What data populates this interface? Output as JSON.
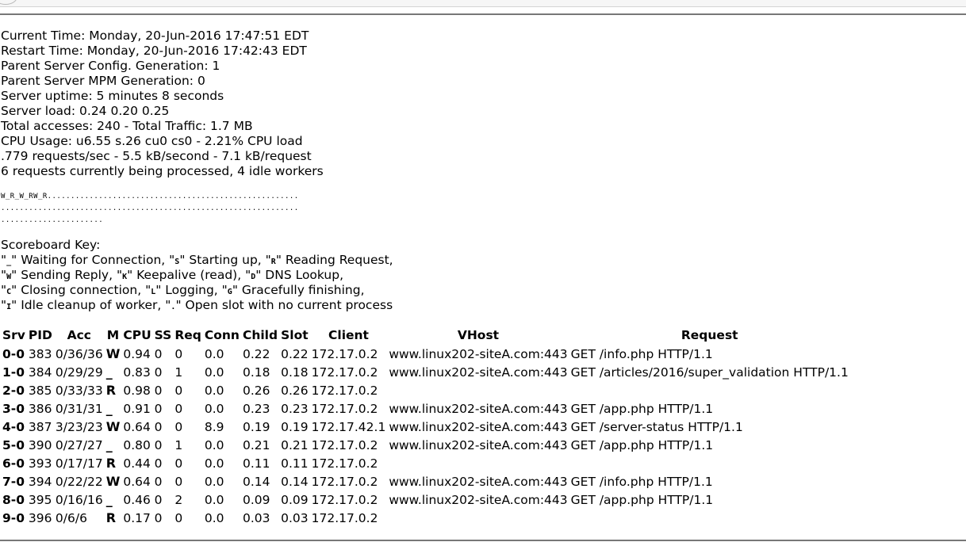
{
  "server_info": [
    "Current Time: Monday, 20-Jun-2016 17:47:51 EDT",
    "Restart Time: Monday, 20-Jun-2016 17:42:43 EDT",
    "Parent Server Config. Generation: 1",
    "Parent Server MPM Generation: 0",
    "Server uptime: 5 minutes 8 seconds",
    "Server load: 0.24 0.20 0.25",
    "Total accesses: 240 - Total Traffic: 1.7 MB",
    "CPU Usage: u6.55 s.26 cu0 cs0 - 2.21% CPU load",
    ".779 requests/sec - 5.5 kB/second - 7.1 kB/request",
    "6 requests currently being processed, 4 idle workers"
  ],
  "scoreboard": [
    "W_R_W_RW_R......................................................",
    "................................................................",
    "......................"
  ],
  "key": {
    "title": "Scoreboard Key:",
    "lines": [
      [
        [
          "\"",
          "_",
          "\" Waiting for Connection, \""
        ],
        [
          "S",
          "\" Starting up, \""
        ],
        [
          "R",
          "\" Reading Request,"
        ]
      ],
      [
        [
          "\"",
          "W",
          "\" Sending Reply, \""
        ],
        [
          "K",
          "\" Keepalive (read), \""
        ],
        [
          "D",
          "\" DNS Lookup,"
        ]
      ],
      [
        [
          "\"",
          "C",
          "\" Closing connection, \""
        ],
        [
          "L",
          "\" Logging, \""
        ],
        [
          "G",
          "\" Gracefully finishing,"
        ]
      ],
      [
        [
          "\"",
          "I",
          "\" Idle cleanup of worker, \""
        ],
        [
          ".",
          "\" Open slot with no current process"
        ]
      ]
    ]
  },
  "table": {
    "headers": [
      "Srv",
      "PID",
      "Acc",
      "M",
      "CPU",
      "SS",
      "Req",
      "Conn",
      "Child",
      "Slot",
      "Client",
      "VHost",
      "Request"
    ],
    "rows": [
      [
        "0-0",
        "383",
        "0/36/36",
        "W",
        "0.94",
        "0",
        "0",
        "0.0",
        "0.22",
        "0.22",
        "172.17.0.2",
        "www.linux202-siteA.com:443",
        "GET /info.php HTTP/1.1"
      ],
      [
        "1-0",
        "384",
        "0/29/29",
        "_",
        "0.83",
        "0",
        "1",
        "0.0",
        "0.18",
        "0.18",
        "172.17.0.2",
        "www.linux202-siteA.com:443",
        "GET /articles/2016/super_validation HTTP/1.1"
      ],
      [
        "2-0",
        "385",
        "0/33/33",
        "R",
        "0.98",
        "0",
        "0",
        "0.0",
        "0.26",
        "0.26",
        "172.17.0.2",
        "",
        ""
      ],
      [
        "3-0",
        "386",
        "0/31/31",
        "_",
        "0.91",
        "0",
        "0",
        "0.0",
        "0.23",
        "0.23",
        "172.17.0.2",
        "www.linux202-siteA.com:443",
        "GET /app.php HTTP/1.1"
      ],
      [
        "4-0",
        "387",
        "3/23/23",
        "W",
        "0.64",
        "0",
        "0",
        "8.9",
        "0.19",
        "0.19",
        "172.17.42.1",
        "www.linux202-siteA.com:443",
        "GET /server-status HTTP/1.1"
      ],
      [
        "5-0",
        "390",
        "0/27/27",
        "_",
        "0.80",
        "0",
        "1",
        "0.0",
        "0.21",
        "0.21",
        "172.17.0.2",
        "www.linux202-siteA.com:443",
        "GET /app.php HTTP/1.1"
      ],
      [
        "6-0",
        "393",
        "0/17/17",
        "R",
        "0.44",
        "0",
        "0",
        "0.0",
        "0.11",
        "0.11",
        "172.17.0.2",
        "",
        ""
      ],
      [
        "7-0",
        "394",
        "0/22/22",
        "W",
        "0.64",
        "0",
        "0",
        "0.0",
        "0.14",
        "0.14",
        "172.17.0.2",
        "www.linux202-siteA.com:443",
        "GET /info.php HTTP/1.1"
      ],
      [
        "8-0",
        "395",
        "0/16/16",
        "_",
        "0.46",
        "0",
        "2",
        "0.0",
        "0.09",
        "0.09",
        "172.17.0.2",
        "www.linux202-siteA.com:443",
        "GET /app.php HTTP/1.1"
      ],
      [
        "9-0",
        "396",
        "0/6/6",
        "R",
        "0.17",
        "0",
        "0",
        "0.0",
        "0.03",
        "0.03",
        "172.17.0.2",
        "",
        ""
      ]
    ]
  }
}
